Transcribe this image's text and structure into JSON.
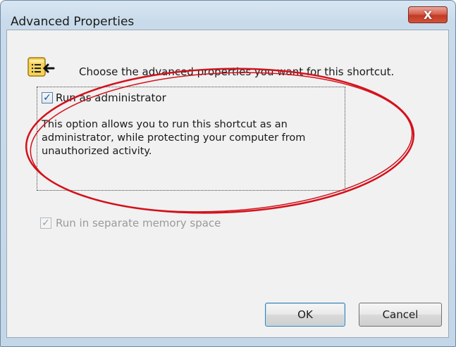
{
  "window": {
    "title": "Advanced Properties",
    "close_glyph": "X"
  },
  "dialog": {
    "intro": "Choose the advanced properties you want for this shortcut.",
    "run_as_admin": {
      "label": "Run as administrator",
      "checked": true,
      "description": "This option allows you to run this shortcut as an administrator, while protecting your computer from unauthorized activity."
    },
    "separate_memory": {
      "label": "Run in separate memory space",
      "checked": true,
      "enabled": false
    }
  },
  "buttons": {
    "ok": "OK",
    "cancel": "Cancel"
  },
  "colors": {
    "annotation_ellipse": "#d4111b",
    "check_mark": "#1f4f96"
  }
}
